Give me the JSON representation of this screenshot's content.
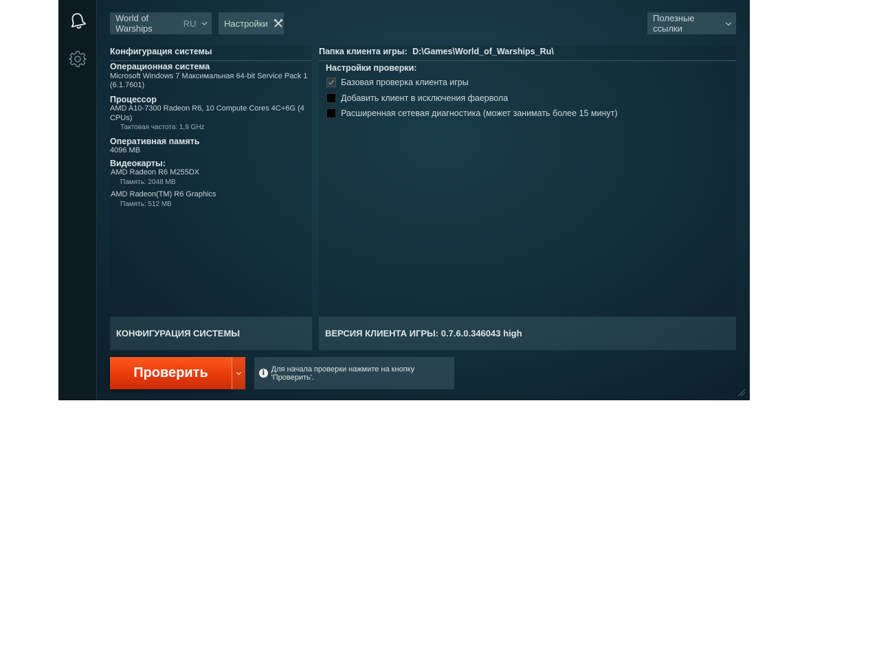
{
  "header": {
    "game_select": {
      "label": "World of Warships",
      "region": "RU"
    },
    "settings_tab": {
      "label": "Настройки"
    },
    "links_menu": {
      "label": "Полезные ссылки"
    }
  },
  "system": {
    "title": "Конфигурация системы",
    "os_label": "Операционная система",
    "os_value": "Microsoft Windows 7 Максимальная  64-bit Service Pack 1 (6.1.7601)",
    "cpu_label": "Процессор",
    "cpu_value": "AMD A10-7300 Radeon R6, 10 Compute Cores 4C+6G  (4 CPUs)",
    "cpu_clock": "Тактовая частота: 1,9 GHz",
    "ram_label": "Оперативная память",
    "ram_value": "4096  MB",
    "gpu_label": "Видеокарты:",
    "gpus": [
      {
        "name": "AMD Radeon R6 M255DX",
        "memory": "Память: 2048  MB"
      },
      {
        "name": "AMD Radeon(TM) R6 Graphics",
        "memory": "Память: 512  MB"
      }
    ],
    "footer": "КОНФИГУРАЦИЯ СИСТЕМЫ"
  },
  "client": {
    "folder_label": "Папка клиента игры:",
    "folder_path": "D:\\Games\\World_of_Warships_Ru\\",
    "options_title": "Настройки проверки:",
    "options": [
      {
        "label": "Базовая проверка клиента игры",
        "checked": true
      },
      {
        "label": "Добавить клиент в исключения фаервола",
        "checked": false
      },
      {
        "label": "Расширенная сетевая диагностика (может занимать более 15 минут)",
        "checked": false
      }
    ],
    "footer": "ВЕРСИЯ КЛИЕНТА ИГРЫ: 0.7.6.0.346043 high"
  },
  "actions": {
    "check_button": "Проверить",
    "hint": "Для начала проверки нажмите на кнопку 'Проверить'.",
    "info_icon": "i"
  },
  "colors": {
    "accent": "#e8400e",
    "panel": "#2a4a56",
    "background": "#143240"
  }
}
